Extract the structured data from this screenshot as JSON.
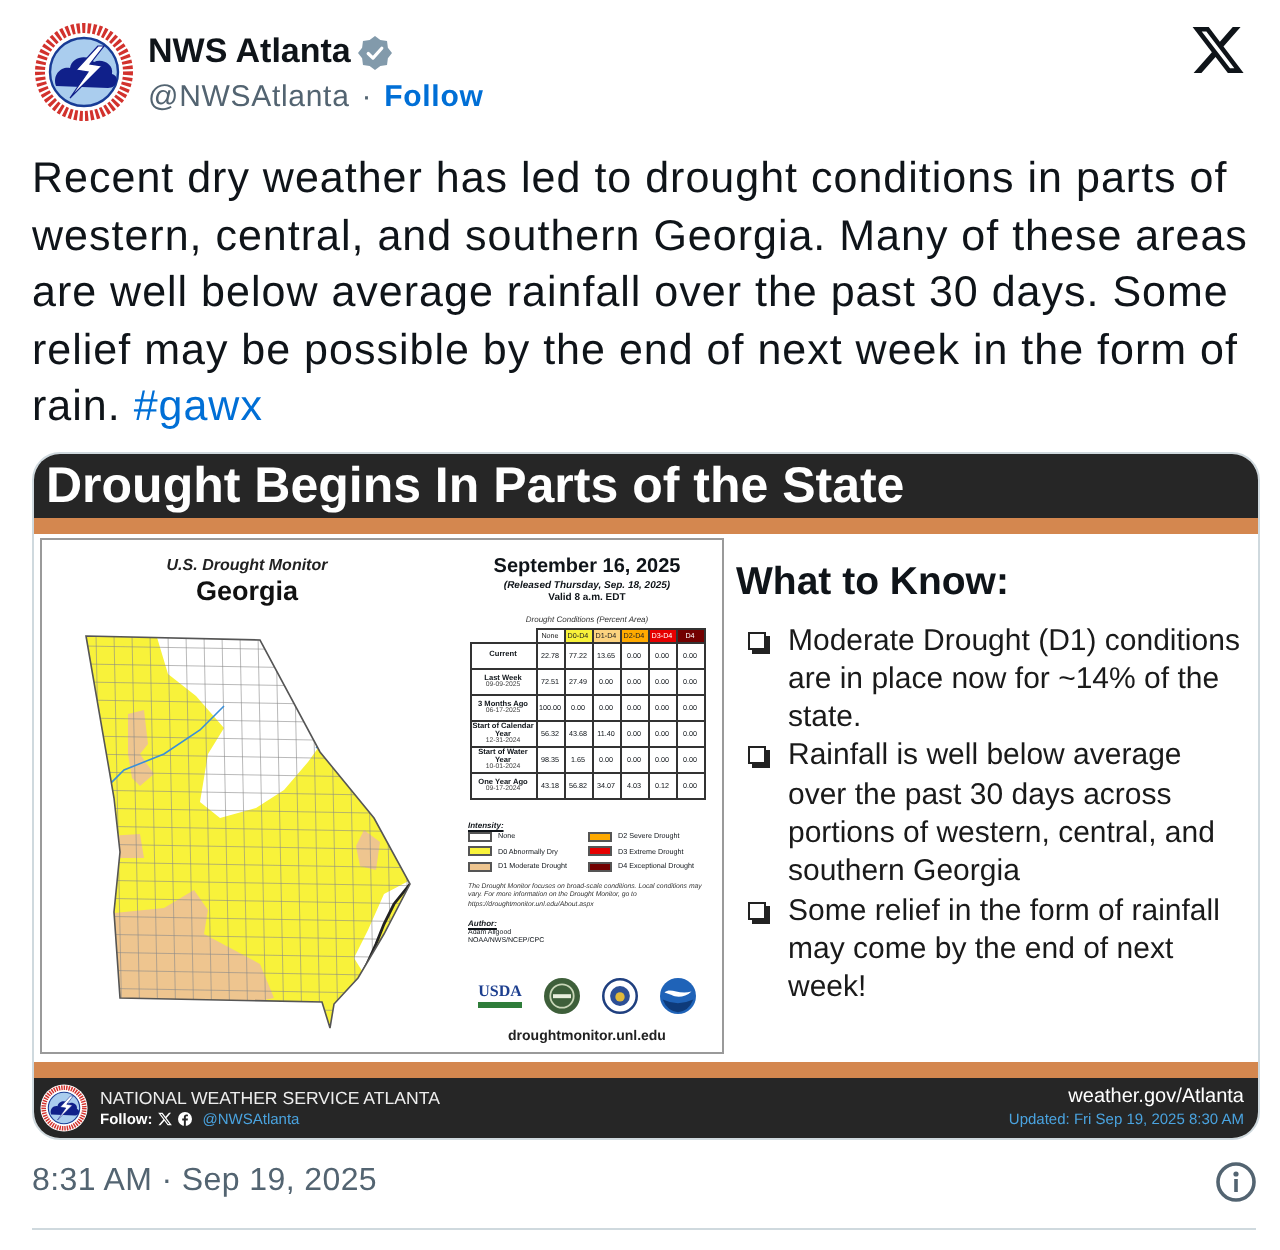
{
  "post": {
    "author": {
      "name": "NWS Atlanta",
      "verified": true,
      "handle": "@NWSAtlanta",
      "separator": "·",
      "follow": "Follow"
    },
    "text": "Recent dry weather has led to drought conditions in parts of western, central, and southern Georgia. Many of these areas are well below average rainfall over the past 30 days. Some relief may be possible by the end of next week in the form of rain.",
    "hashtag": "#gawx"
  },
  "graphic": {
    "title": "Drought Begins In Parts of the State",
    "monitor": {
      "heading": "U.S. Drought Monitor",
      "region": "Georgia",
      "date": "September 16, 2025",
      "released": "(Released Thursday, Sep. 18, 2025)",
      "valid": "Valid 8 a.m. EDT",
      "table_caption": "Drought Conditions (Percent Area)",
      "columns": [
        {
          "label": "None",
          "color": "#ffffff"
        },
        {
          "label": "D0-D4",
          "color": "#f8f23a"
        },
        {
          "label": "D1-D4",
          "color": "#fcd37f"
        },
        {
          "label": "D2-D4",
          "color": "#ffaa00"
        },
        {
          "label": "D3-D4",
          "color": "#e60000"
        },
        {
          "label": "D4",
          "color": "#730000"
        }
      ],
      "rows": [
        {
          "label": "Current",
          "values": [
            "22.78",
            "77.22",
            "13.65",
            "0.00",
            "0.00",
            "0.00"
          ]
        },
        {
          "label": "Last Week",
          "date": "09-09-2025",
          "values": [
            "72.51",
            "27.49",
            "0.00",
            "0.00",
            "0.00",
            "0.00"
          ]
        },
        {
          "label": "3 Months Ago",
          "date": "06-17-2025",
          "values": [
            "100.00",
            "0.00",
            "0.00",
            "0.00",
            "0.00",
            "0.00"
          ]
        },
        {
          "label": "Start of Calendar Year",
          "date": "12-31-2024",
          "values": [
            "56.32",
            "43.68",
            "11.40",
            "0.00",
            "0.00",
            "0.00"
          ]
        },
        {
          "label": "Start of Water Year",
          "date": "10-01-2024",
          "values": [
            "98.35",
            "1.65",
            "0.00",
            "0.00",
            "0.00",
            "0.00"
          ]
        },
        {
          "label": "One Year Ago",
          "date": "09-17-2024",
          "values": [
            "43.18",
            "56.82",
            "34.07",
            "4.03",
            "0.12",
            "0.00"
          ]
        }
      ],
      "legend_title": "Intensity:",
      "legend": [
        {
          "label": "None",
          "color": "#ffffff"
        },
        {
          "label": "D0 Abnormally Dry",
          "color": "#f8f23a"
        },
        {
          "label": "D1 Moderate Drought",
          "color": "#eec58f"
        },
        {
          "label": "D2 Severe Drought",
          "color": "#ffaa00"
        },
        {
          "label": "D3 Extreme Drought",
          "color": "#e60000"
        },
        {
          "label": "D4 Exceptional Drought",
          "color": "#730000"
        }
      ],
      "note": "The Drought Monitor focuses on broad-scale conditions. Local conditions may vary. For more information on the Drought Monitor, go to https://droughtmonitor.unl.edu/About.aspx",
      "author_label": "Author:",
      "author": "Adam Allgood",
      "author_org": "NOAA/NWS/NCEP/CPC",
      "logo_text": "USDA",
      "url": "droughtmonitor.unl.edu"
    },
    "what_to_know": {
      "heading": "What to Know:",
      "bullets": [
        "Moderate Drought (D1) conditions are in place now for ~14% of the state.",
        "Rainfall is well below average over the past 30 days across portions of western, central, and southern Georgia",
        "Some relief in the form of rainfall may come by the end of next week!"
      ]
    },
    "footer": {
      "office": "NATIONAL WEATHER SERVICE ATLANTA",
      "follow_label": "Follow:",
      "handle": "@NWSAtlanta",
      "website": "weather.gov/Atlanta",
      "updated": "Updated: Fri Sep 19, 2025 8:30 AM"
    }
  },
  "timestamp": "8:31 AM · Sep 19, 2025"
}
